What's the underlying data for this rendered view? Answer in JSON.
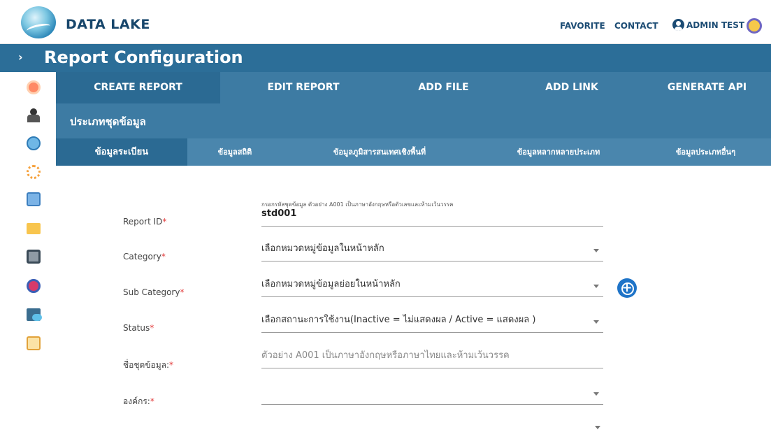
{
  "header": {
    "brand": "DATA LAKE",
    "nav": {
      "favorite": "FAVORITE",
      "contact": "CONTACT",
      "user": "ADMIN TEST"
    }
  },
  "title": {
    "chevron": "›",
    "text": "Report Configuration"
  },
  "sidebar": {
    "icons": [
      "app-logo-icon",
      "users-icon",
      "globe-icon",
      "network-icon",
      "clipboard-icon",
      "folder-icon",
      "monitor-icon",
      "camera-icon",
      "cloud-icon",
      "calendar-icon"
    ]
  },
  "main_tabs": [
    "CREATE REPORT",
    "EDIT REPORT",
    "ADD FILE",
    "ADD LINK",
    "GENERATE API"
  ],
  "section": {
    "title": "ประเภทชุดข้อมูล"
  },
  "sub_tabs": [
    "ข้อมูลระเบียน",
    "ข้อมูลสถิติ",
    "ข้อมูลภูมิสารสนเทศเชิงพื้นที่",
    "ข้อมูลหลากหลายประเภท",
    "ข้อมูลประเภทอื่นๆ"
  ],
  "form": {
    "report_id": {
      "label": "Report ID",
      "required_mark": "*",
      "hint": "กรอกรหัสชุดข้อมูล ตัวอย่าง A001 เป็นภาษาอังกฤษหรือตัวเลขและห้ามเว้นวรรค",
      "value": "std001"
    },
    "category": {
      "label": "Category",
      "required_mark": "*",
      "value": "เลือกหมวดหมู่ข้อมูลในหน้าหลัก"
    },
    "sub_category": {
      "label": "Sub Category",
      "required_mark": "*",
      "value": "เลือกหมวดหมู่ข้อมูลย่อยในหน้าหลัก"
    },
    "status": {
      "label": "Status",
      "required_mark": "*",
      "value": "เลือกสถานะการใช้งาน(Inactive = ไม่แสดงผล / Active = แสดงผล )"
    },
    "dataset_name": {
      "label": "ชื่อชุดข้อมูล:",
      "required_mark": "*",
      "placeholder": "ตัวอย่าง A001 เป็นภาษาอังกฤษหรือภาษาไทยและห้ามเว้นวรรค"
    },
    "organization": {
      "label": "องค์กร:",
      "required_mark": "*",
      "value": ""
    },
    "add_button": "+"
  },
  "colors": {
    "primary": "#2c6e98",
    "tab_bg": "#3d7ba3",
    "subtab_bg": "#4a86ad",
    "required": "#e23a3a",
    "add_button": "#1f74c8"
  }
}
